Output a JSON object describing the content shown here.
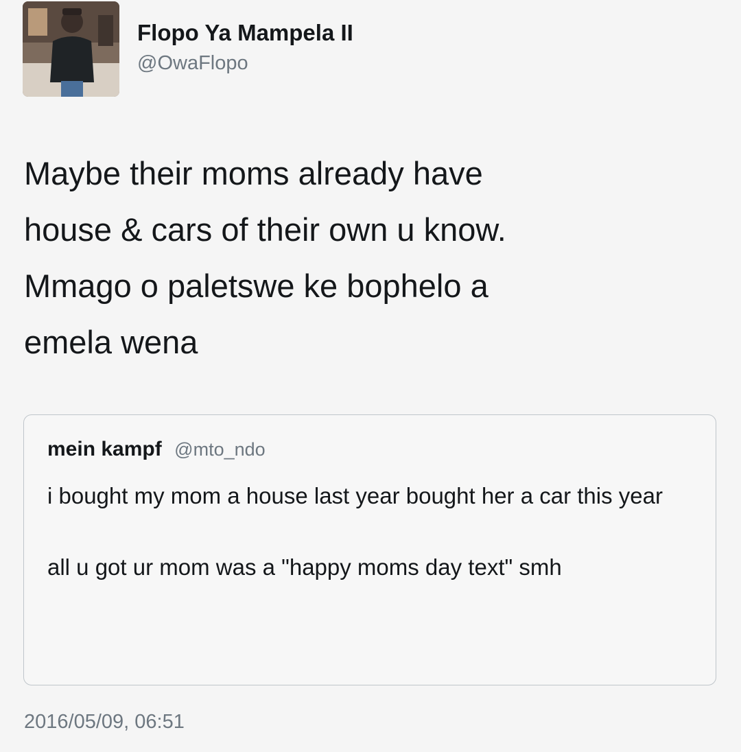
{
  "tweet": {
    "author": {
      "display_name": "Flopo Ya Mampela II",
      "handle": "@OwaFlopo"
    },
    "text_lines": [
      "Maybe their moms already have",
      "house & cars of their own u know.",
      "Mmago o paletswe ke bophelo a",
      "emela wena"
    ],
    "quoted": {
      "display_name": "mein kampf",
      "handle": "@mto_ndo",
      "paragraphs": [
        "i bought my mom a house last year bought her a car this year",
        "all u got ur mom was a \"happy moms day text\" smh"
      ]
    },
    "timestamp": "2016/05/09, 06:51"
  },
  "colors": {
    "background": "#f5f5f5",
    "text_primary": "#14171a",
    "text_secondary": "#6d7780",
    "card_border": "#bfc5ca"
  },
  "icons": {
    "avatar": "profile-photo"
  }
}
